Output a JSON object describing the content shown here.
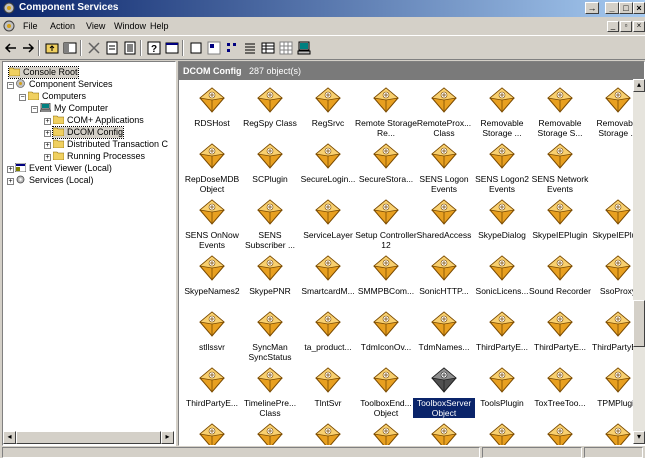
{
  "window": {
    "title": "Component Services"
  },
  "menu": [
    {
      "label": "File",
      "u": "F"
    },
    {
      "label": "Action",
      "u": "A"
    },
    {
      "label": "View",
      "u": "V"
    },
    {
      "label": "Window",
      "u": "W"
    },
    {
      "label": "Help",
      "u": "H"
    }
  ],
  "tree": {
    "items": [
      {
        "label": "Console Root"
      },
      {
        "label": "Component Services"
      },
      {
        "label": "Computers"
      },
      {
        "label": "My Computer"
      },
      {
        "label": "COM+ Applications"
      },
      {
        "label": "DCOM Config"
      },
      {
        "label": "Distributed Transaction C"
      },
      {
        "label": "Running Processes"
      },
      {
        "label": "Event Viewer (Local)"
      },
      {
        "label": "Services (Local)"
      }
    ]
  },
  "pane": {
    "title": "DCOM Config",
    "count": "287 object(s)"
  },
  "icons": [
    "RDSHost",
    "RegSpy Class",
    "RegSrvc",
    "Remote Storage Re...",
    "RemoteProx... Class",
    "Removable Storage ...",
    "Removable Storage S...",
    "Removable Storage ...",
    "RepDoseMDB Object",
    "SCPlugin",
    "SecureLogin...",
    "SecureStora...",
    "SENS Logon Events",
    "SENS Logon2 Events",
    "SENS Network Events",
    "",
    "SENS OnNow Events",
    "SENS Subscriber ...",
    "ServiceLayer",
    "Setup Controller 12",
    "SharedAccess",
    "SkypeDialog",
    "SkypeIEPlugin",
    "SkypeIEPlu...",
    "SkypeNames2",
    "SkypePNR",
    "SmartcardM...",
    "SMMPBCom...",
    "SonicHTTP...",
    "SonicLicens...",
    "Sound Recorder",
    "SsoProxy",
    "stllssvr",
    "SyncMan SyncStatus",
    "ta_product...",
    "TdmIconOv...",
    "TdmNames...",
    "ThirdPartyE...",
    "ThirdPartyE...",
    "ThirdPartyE...",
    "ThirdPartyE...",
    "TimelinePre... Class",
    "TlntSvr",
    "ToolboxEnd... Object",
    "ToolboxServer Object",
    "ToolsPlugin",
    "ToxTreeToo...",
    "TPMPlugin"
  ],
  "selected_icon": "ToolboxServer Object"
}
